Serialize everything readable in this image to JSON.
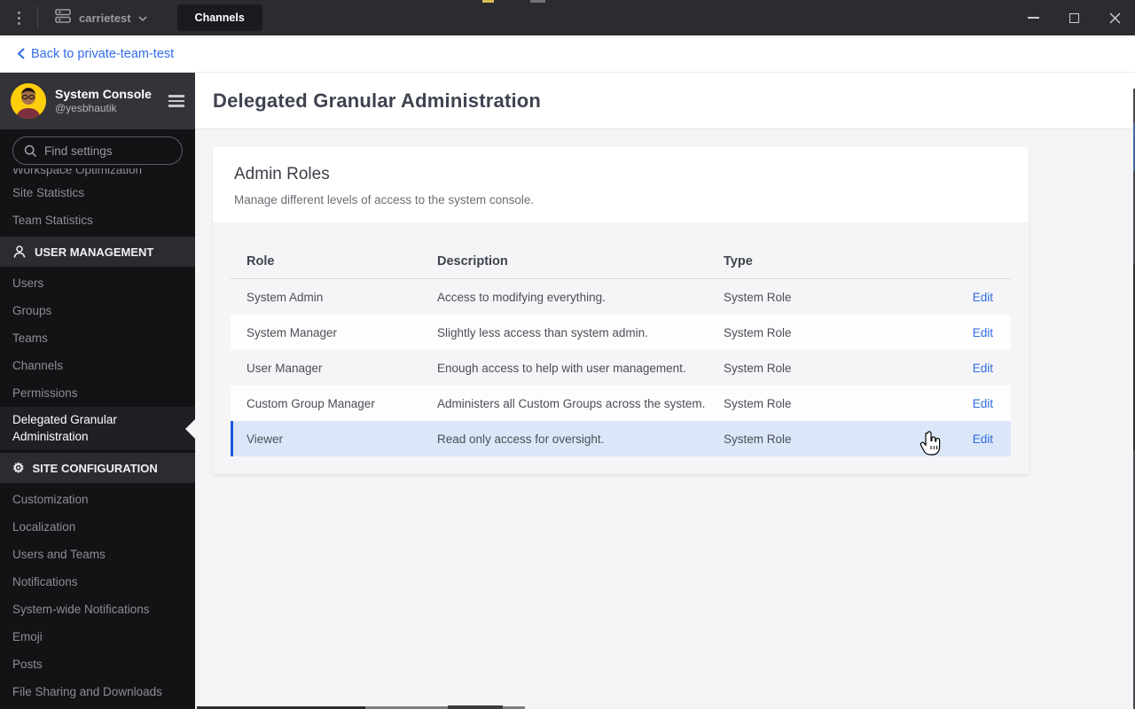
{
  "colors": {
    "accent_blue": "#1c58d9",
    "link_blue": "#2f6be4",
    "highlight_row_bg": "#dbe7f8",
    "titlebar_bg": "#2c2b30",
    "sidebar_bg": "#131316",
    "content_bg": "#f4f4f6"
  },
  "titlebar": {
    "server_name": "carrietest",
    "active_tab": "Channels"
  },
  "backbar": {
    "back_link": "Back to private-team-test"
  },
  "sidebar": {
    "title": "System Console",
    "username": "@yesbhautik",
    "search_placeholder": "Find settings",
    "items": [
      {
        "label": "Workspace Optimization"
      },
      {
        "label": "Site Statistics"
      },
      {
        "label": "Team Statistics"
      },
      {
        "label": "USER MANAGEMENT"
      },
      {
        "label": "Users"
      },
      {
        "label": "Groups"
      },
      {
        "label": "Teams"
      },
      {
        "label": "Channels"
      },
      {
        "label": "Permissions"
      },
      {
        "label": "Delegated Granular Administration"
      },
      {
        "label": "SITE CONFIGURATION"
      },
      {
        "label": "Customization"
      },
      {
        "label": "Localization"
      },
      {
        "label": "Users and Teams"
      },
      {
        "label": "Notifications"
      },
      {
        "label": "System-wide Notifications"
      },
      {
        "label": "Emoji"
      },
      {
        "label": "Posts"
      },
      {
        "label": "File Sharing and Downloads"
      }
    ]
  },
  "main": {
    "page_title": "Delegated Granular Administration",
    "card": {
      "title": "Admin Roles",
      "subtitle": "Manage different levels of access to the system console."
    },
    "table": {
      "columns": {
        "role": "Role",
        "description": "Description",
        "type": "Type"
      },
      "rows": [
        {
          "role": "System Admin",
          "description": "Access to modifying everything.",
          "type": "System Role",
          "action": "Edit"
        },
        {
          "role": "System Manager",
          "description": "Slightly less access than system admin.",
          "type": "System Role",
          "action": "Edit"
        },
        {
          "role": "User Manager",
          "description": "Enough access to help with user management.",
          "type": "System Role",
          "action": "Edit"
        },
        {
          "role": "Custom Group Manager",
          "description": "Administers all Custom Groups across the system.",
          "type": "System Role",
          "action": "Edit"
        },
        {
          "role": "Viewer",
          "description": "Read only access for oversight.",
          "type": "System Role",
          "action": "Edit"
        }
      ]
    }
  }
}
